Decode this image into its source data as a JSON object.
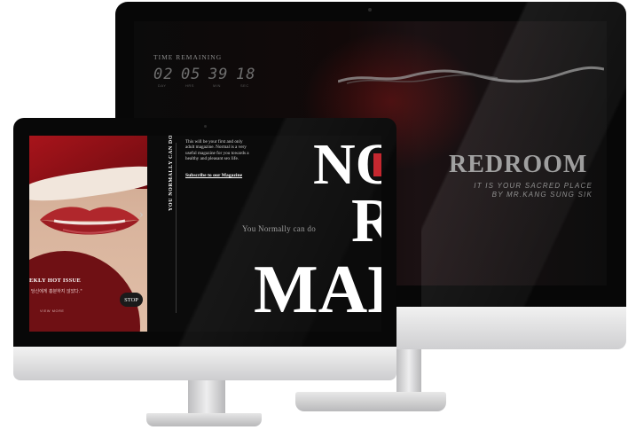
{
  "back_screen": {
    "timer_label": "TIME REMAINING",
    "timer": [
      {
        "value": "02",
        "unit": "DAY"
      },
      {
        "value": "05",
        "unit": "HRS"
      },
      {
        "value": "39",
        "unit": "MIN"
      },
      {
        "value": "18",
        "unit": "SEC"
      }
    ],
    "brand_title": "REDROOM",
    "tagline_1": "IT IS YOUR SACRED PLACE",
    "tagline_2": "BY MR.KANG SUNG SIK"
  },
  "front_screen": {
    "hot_issue": "EKLY HOT ISSUE",
    "issue_subtitle": "당신에게 흥분하지 않았다.\"",
    "view_more": "VIEW MORE",
    "stop_label": "STOP",
    "slider_arrow": "›",
    "vertical_text": "YOU NORMALLY CAN DO",
    "intro_text": "This will be your first and only adult magazine. Normal is a very useful magazine for you towards a healthy and pleasant sex life.",
    "subscribe_label": "Subscribe to our Magazine",
    "normally_text": "You Normally can do",
    "big_line1": "NO",
    "big_line2": "R",
    "big_line3": "MAL"
  },
  "colors": {
    "accent_red": "#c4232b",
    "dark_bg": "#0b0b0b"
  }
}
